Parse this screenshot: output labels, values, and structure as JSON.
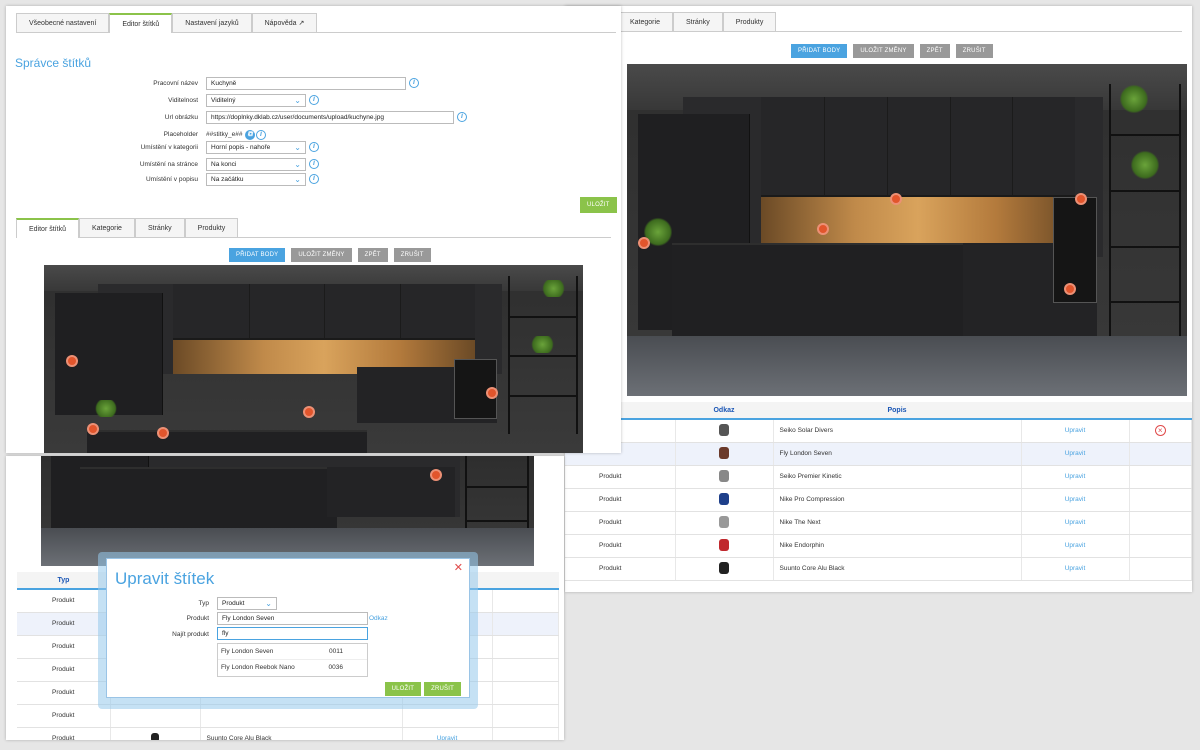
{
  "panel1": {
    "top_tabs": [
      "Všeobecné nastavení",
      "Editor štítků",
      "Nastavení jazyků",
      "Nápověda"
    ],
    "title": "Správce štítků",
    "form": [
      {
        "label": "Pracovní název",
        "value": "Kuchyně",
        "type": "text"
      },
      {
        "label": "Viditelnost",
        "value": "Viditelný",
        "type": "select"
      },
      {
        "label": "Url obrázku",
        "value": "https://doplnky.dklab.cz/user/documents/upload/kuchyne.jpg",
        "type": "text"
      },
      {
        "label": "Placeholder",
        "value": "##stitky_e##",
        "type": "static"
      },
      {
        "label": "Umístění v kategorii",
        "value": "Horní popis - nahoře",
        "type": "select"
      },
      {
        "label": "Umístění na stránce",
        "value": "Na konci",
        "type": "select"
      },
      {
        "label": "Umístění v popisu",
        "value": "Na začátku",
        "type": "select"
      }
    ],
    "save_label": "Uložit",
    "sub_tabs": [
      "Editor štítků",
      "Kategorie",
      "Stránky",
      "Produkty"
    ],
    "toolbar": {
      "add": "Přidat body",
      "save": "Uložit změny",
      "back": "Zpět",
      "cancel": "Zrušit"
    }
  },
  "panel2": {
    "tabs": [
      "Kategorie",
      "Stránky",
      "Produkty"
    ],
    "toolbar": {
      "add": "Přidat body",
      "save": "Uložit změny",
      "back": "Zpět",
      "cancel": "Zrušit"
    },
    "table": {
      "headers": [
        "",
        "Odkaz",
        "Popis",
        "",
        ""
      ],
      "rows": [
        {
          "type": "",
          "desc": "Seiko Solar Divers",
          "action": "Upravit",
          "color": "#555555"
        },
        {
          "type": "",
          "desc": "Fly London Seven",
          "action": "Upravit",
          "color": "#6b3a2a"
        },
        {
          "type": "Produkt",
          "desc": "Seiko Premier Kinetic",
          "action": "Upravit",
          "color": "#888888"
        },
        {
          "type": "Produkt",
          "desc": "Nike Pro Compression",
          "action": "Upravit",
          "color": "#1e3f8a"
        },
        {
          "type": "Produkt",
          "desc": "Nike The Next",
          "action": "Upravit",
          "color": "#999999"
        },
        {
          "type": "Produkt",
          "desc": "Nike Endorphin",
          "action": "Upravit",
          "color": "#c0282d"
        },
        {
          "type": "Produkt",
          "desc": "Suunto Core Alu Black",
          "action": "Upravit",
          "color": "#222222"
        }
      ]
    }
  },
  "panel3": {
    "table_header": "Typ",
    "rows": [
      "Produkt",
      "Produkt",
      "Produkt",
      "Produkt",
      "Produkt",
      "Produkt",
      "Produkt"
    ],
    "last_desc": "Suunto Core Alu Black",
    "last_action": "Upravit",
    "odkaz": "Odkaz"
  },
  "modal": {
    "title": "Upravit štítek",
    "type_label": "Typ",
    "type_value": "Produkt",
    "product_label": "Produkt",
    "product_value": "Fly London Seven",
    "search_label": "Najít produkt",
    "search_value": "fly",
    "results": [
      {
        "name": "Fly London Seven",
        "code": "0011"
      },
      {
        "name": "Fly London Reebok Nano",
        "code": "0036"
      }
    ],
    "save_label": "Uložit",
    "cancel_label": "Zrušit"
  },
  "colors": {
    "accent": "#4aa3e0",
    "green": "#8bc34a",
    "link": "#1a56b5"
  }
}
